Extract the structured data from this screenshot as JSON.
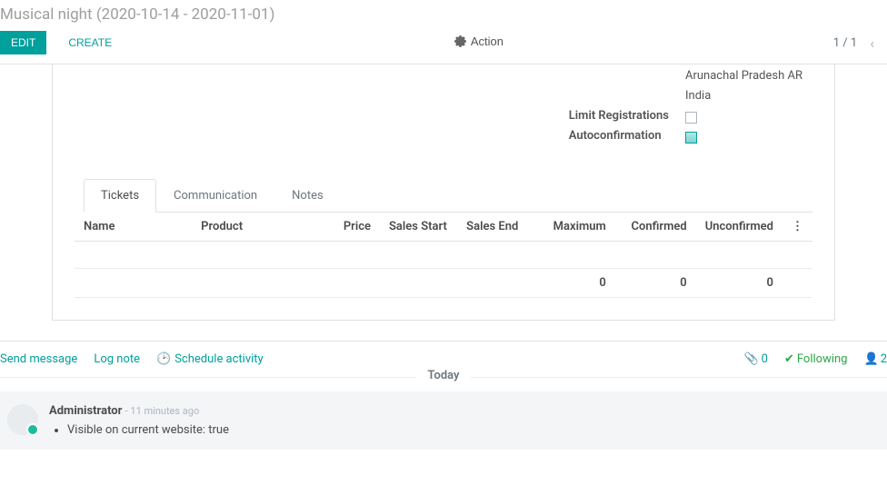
{
  "breadcrumb": "Musical night (2020-10-14 - 2020-11-01)",
  "toolbar": {
    "edit": "EDIT",
    "create": "CREATE",
    "action": "Action",
    "pager": "1 / 1"
  },
  "venue": {
    "state": "Arunachal Pradesh AR",
    "country": "India",
    "limit_reg_label": "Limit Registrations",
    "autoconf_label": "Autoconfirmation"
  },
  "tabs": {
    "tickets": "Tickets",
    "communication": "Communication",
    "notes": "Notes"
  },
  "table": {
    "headers": {
      "name": "Name",
      "product": "Product",
      "price": "Price",
      "sales_start": "Sales Start",
      "sales_end": "Sales End",
      "maximum": "Maximum",
      "confirmed": "Confirmed",
      "unconfirmed": "Unconfirmed"
    },
    "totals": {
      "maximum": "0",
      "confirmed": "0",
      "unconfirmed": "0"
    }
  },
  "chatter": {
    "send": "Send message",
    "log": "Log note",
    "schedule": "Schedule activity",
    "attach_count": "0",
    "following": "Following",
    "followers_count": "2",
    "separator": "Today"
  },
  "message": {
    "author": "Administrator",
    "time": "- 11 minutes ago",
    "bullet": "Visible on current website: true"
  }
}
